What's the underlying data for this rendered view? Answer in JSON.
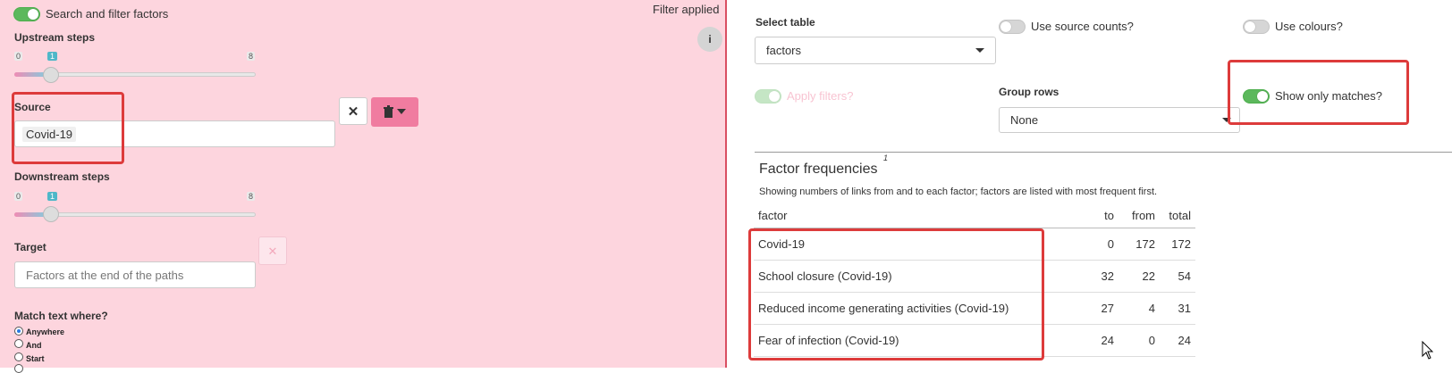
{
  "left": {
    "filter_toggle_label": "Search and filter factors",
    "filter_status": "Filter applied",
    "info_icon_glyph": "i",
    "upstream": {
      "label": "Upstream steps",
      "min": "0",
      "max": "8",
      "value": "1"
    },
    "source": {
      "label": "Source",
      "chip": "Covid-19",
      "clear_glyph": "✕"
    },
    "downstream": {
      "label": "Downstream steps",
      "min": "0",
      "max": "8",
      "value": "1"
    },
    "target": {
      "label": "Target",
      "placeholder": "Factors at the end of the paths",
      "clear_glyph": "✕"
    },
    "match": {
      "label": "Match text where?",
      "options": [
        "Anywhere",
        "And",
        "Start"
      ],
      "selected": "Anywhere"
    }
  },
  "right": {
    "select_table": {
      "label": "Select table",
      "value": "factors"
    },
    "use_source_counts": {
      "label": "Use source counts?",
      "on": false
    },
    "use_colours": {
      "label": "Use colours?",
      "on": false
    },
    "apply_filters": {
      "label": "Apply filters?",
      "on": true
    },
    "group_rows": {
      "label": "Group rows",
      "value": "None"
    },
    "show_only_matches": {
      "label": "Show only matches?",
      "on": true
    },
    "footnote_marker": "1",
    "title": "Factor frequencies",
    "subtitle": "Showing numbers of links from and to each factor; factors are listed with most frequent first.",
    "columns": [
      "factor",
      "to",
      "from",
      "total"
    ],
    "rows": [
      {
        "factor": "Covid-19",
        "to": "0",
        "from": "172",
        "total": "172"
      },
      {
        "factor": "School closure (Covid-19)",
        "to": "32",
        "from": "22",
        "total": "54"
      },
      {
        "factor": "Reduced income generating activities (Covid-19)",
        "to": "27",
        "from": "4",
        "total": "31"
      },
      {
        "factor": "Fear of infection (Covid-19)",
        "to": "24",
        "from": "0",
        "total": "24"
      }
    ]
  },
  "colors": {
    "panel_pink": "#fdd5de",
    "accent_pink": "#f07ca0",
    "toggle_green": "#5cb85c",
    "highlight_red": "#dd3b3b"
  }
}
